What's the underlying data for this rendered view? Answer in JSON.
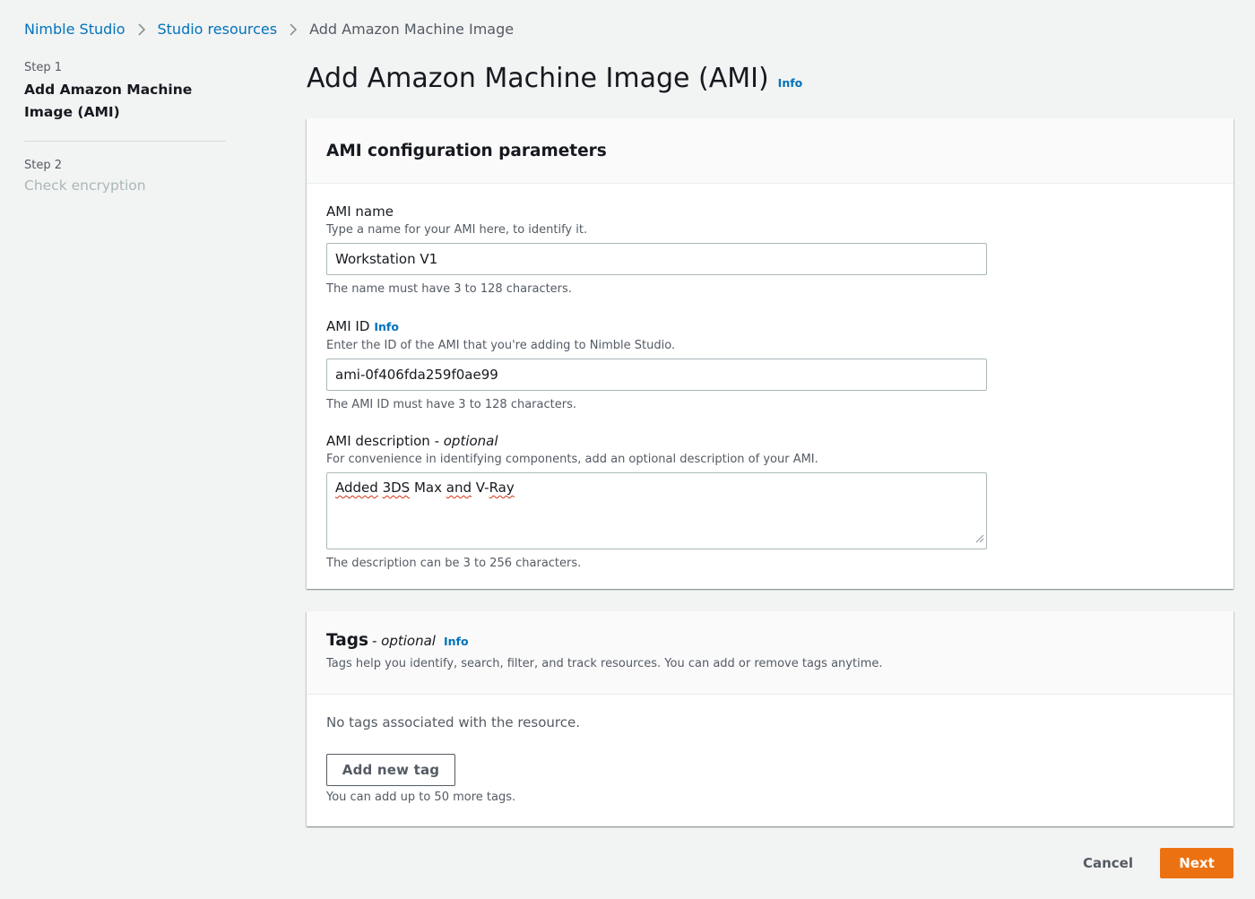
{
  "breadcrumb": {
    "items": [
      {
        "label": "Nimble Studio"
      },
      {
        "label": "Studio resources"
      },
      {
        "label": "Add Amazon Machine Image"
      }
    ]
  },
  "steps": [
    {
      "number": "Step 1",
      "title": "Add Amazon Machine Image (AMI)",
      "state": "active"
    },
    {
      "number": "Step 2",
      "title": "Check encryption",
      "state": "disabled"
    }
  ],
  "header": {
    "title": "Add Amazon Machine Image (AMI)",
    "info": "Info"
  },
  "ami_config": {
    "title": "AMI configuration parameters",
    "name_field": {
      "label": "AMI name",
      "description": "Type a name for your AMI here, to identify it.",
      "value": "Workstation V1",
      "constraint": "The name must have 3 to 128 characters."
    },
    "id_field": {
      "label": "AMI ID",
      "info": "Info",
      "description": "Enter the ID of the AMI that you're adding to Nimble Studio.",
      "value": "ami-0f406fda259f0ae99",
      "constraint": "The AMI ID must have 3 to 128 characters."
    },
    "description_field": {
      "label": "AMI description",
      "optional": "optional",
      "description": "For convenience in identifying components, add an optional description of your AMI.",
      "value_parts": [
        "Added",
        "3DS",
        "Max",
        "and",
        "V-Ray"
      ],
      "constraint": "The description can be 3 to 256 characters."
    }
  },
  "tags": {
    "title": "Tags",
    "optional": "optional",
    "info": "Info",
    "description": "Tags help you identify, search, filter, and track resources. You can add or remove tags anytime.",
    "empty_text": "No tags associated with the resource.",
    "add_button": "Add new tag",
    "limit_text": "You can add up to 50 more tags."
  },
  "footer": {
    "cancel": "Cancel",
    "next": "Next"
  },
  "colors": {
    "link": "#0073bb",
    "primary": "#ec7211",
    "background": "#f2f3f3"
  }
}
